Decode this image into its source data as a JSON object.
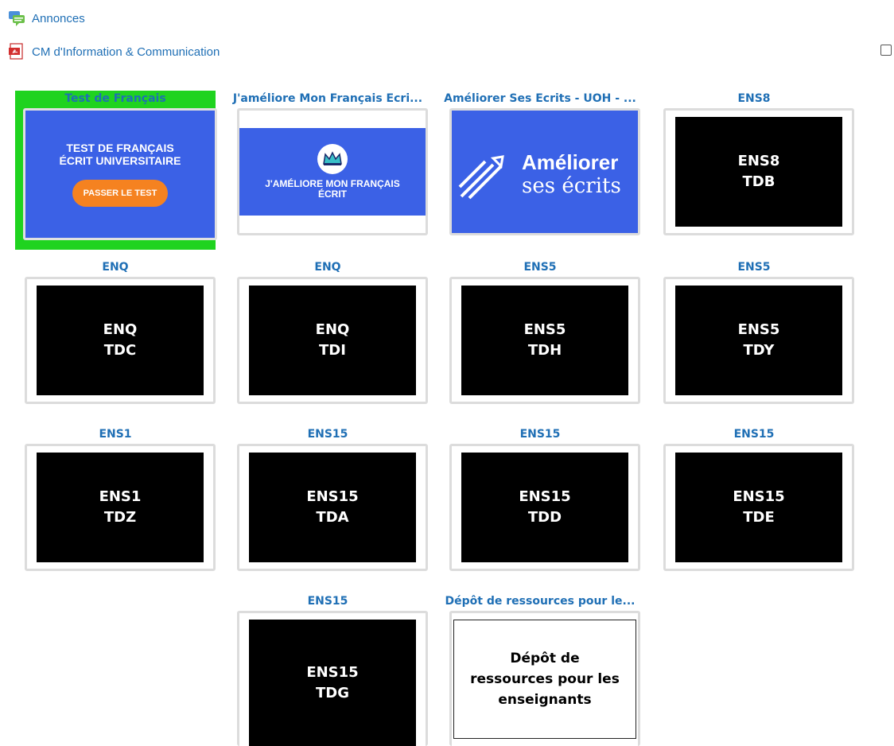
{
  "links": [
    {
      "label": "Annonces",
      "icon": "forum-icon"
    },
    {
      "label": "CM d'Information & Communication",
      "icon": "pdf-icon"
    }
  ],
  "tiles": [
    {
      "title": "Test de Français",
      "card": {
        "line1": "TEST DE FRANÇAIS",
        "line2": "ÉCRIT UNIVERSITAIRE",
        "button": "PASSER LE TEST"
      }
    },
    {
      "title": "J'améliore Mon Français Ecri...",
      "card": {
        "line1": "J'AMÉLIORE MON FRANÇAIS",
        "line2": "ÉCRIT"
      }
    },
    {
      "title": "Améliorer Ses Ecrits - UOH - ...",
      "card": {
        "line1": "Améliorer",
        "line2": "ses écrits"
      }
    },
    {
      "title": "ENS8",
      "card": {
        "line1": "ENS8",
        "line2": "TDB"
      }
    },
    {
      "title": "ENQ",
      "card": {
        "line1": "ENQ",
        "line2": "TDC"
      }
    },
    {
      "title": "ENQ",
      "card": {
        "line1": "ENQ",
        "line2": "TDI"
      }
    },
    {
      "title": "ENS5",
      "card": {
        "line1": "ENS5",
        "line2": "TDH"
      }
    },
    {
      "title": "ENS5",
      "card": {
        "line1": "ENS5",
        "line2": "TDY"
      }
    },
    {
      "title": "ENS1",
      "card": {
        "line1": "ENS1",
        "line2": "TDZ"
      }
    },
    {
      "title": "ENS15",
      "card": {
        "line1": "ENS15",
        "line2": "TDA"
      }
    },
    {
      "title": "ENS15",
      "card": {
        "line1": "ENS15",
        "line2": "TDD"
      }
    },
    {
      "title": "ENS15",
      "card": {
        "line1": "ENS15",
        "line2": "TDE"
      }
    },
    {
      "title": "ENS15",
      "card": {
        "line1": "ENS15",
        "line2": "TDG"
      }
    },
    {
      "title": "Dépôt de ressources pour le...",
      "card": {
        "line1": "Dépôt de",
        "line2": "ressources pour les",
        "line3": "enseignants"
      }
    }
  ],
  "colors": {
    "accent": "#1f6fb5",
    "highlight": "#1fd31f",
    "card_blue": "#3b61e6",
    "button_orange": "#f58220"
  }
}
